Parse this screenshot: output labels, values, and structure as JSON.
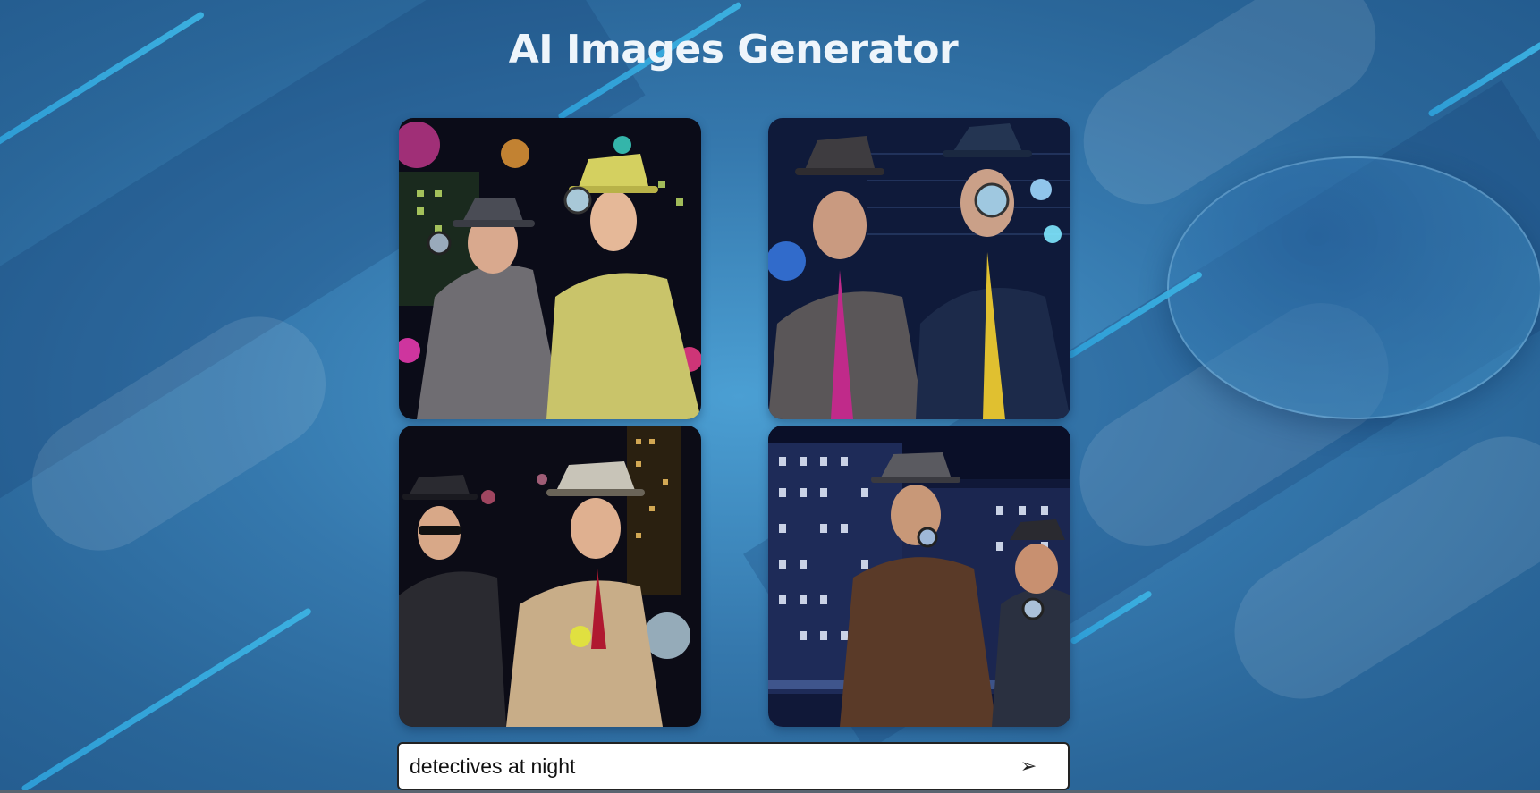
{
  "page": {
    "title": "AI Images Generator"
  },
  "gallery": {
    "images": [
      {
        "icon": "generated-image"
      },
      {
        "icon": "generated-image"
      },
      {
        "icon": "generated-image"
      },
      {
        "icon": "generated-image"
      }
    ]
  },
  "prompt": {
    "value": "detectives at night",
    "send_glyph": "➢"
  },
  "colors": {
    "background": "#3578ad",
    "accent_stripe": "#2e9fd8",
    "title_text": "#eef5fb",
    "input_bg": "#ffffff"
  }
}
